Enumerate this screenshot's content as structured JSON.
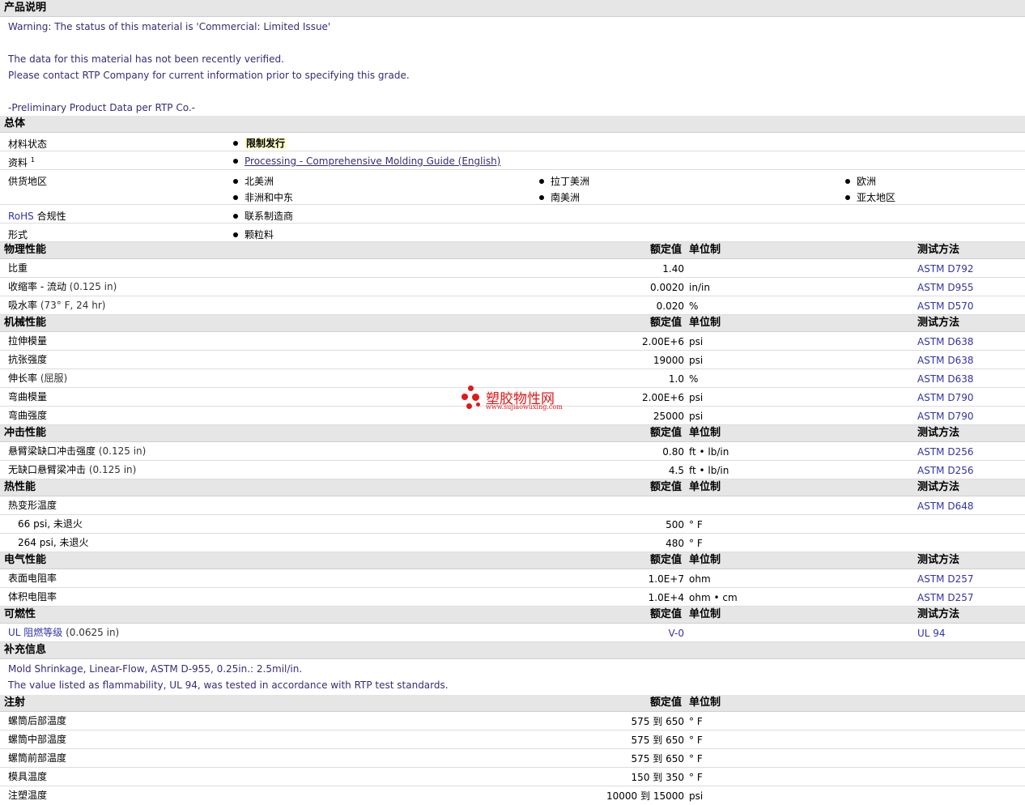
{
  "sections": {
    "desc": "产品说明",
    "general": "总体",
    "physical": "物理性能",
    "mechanical": "机械性能",
    "impact": "冲击性能",
    "thermal": "热性能",
    "electrical": "电气性能",
    "flammability": "可燃性",
    "supplemental": "补充信息",
    "injection": "注射"
  },
  "headers": {
    "nominal": "额定值",
    "unit": "单位制",
    "method": "测试方法"
  },
  "description": {
    "warning": "Warning: The status of this material is 'Commercial: Limited Issue'",
    "line2": "The data for this material has not been recently verified.",
    "line3": "Please contact RTP Company for current information prior to specifying this grade.",
    "line4": "-Preliminary Product Data per RTP Co.-"
  },
  "general": {
    "status_label": "材料状态",
    "status_value": "限制发行",
    "docs_label": "资料",
    "docs_sup": "1",
    "docs_link": "Processing - Comprehensive Molding Guide (English)",
    "regions_label": "供货地区",
    "regions": [
      "北美洲",
      "拉丁美洲",
      "欧洲",
      "非洲和中东",
      "南美洲",
      "亚太地区"
    ],
    "rohs_label_a": "RoHS",
    "rohs_label_b": " 合规性",
    "rohs_value": "联系制造商",
    "form_label": "形式",
    "form_value": "颗粒料"
  },
  "physical": [
    {
      "label": "比重",
      "param": "",
      "value": "1.40",
      "unit": "",
      "method": "ASTM D792"
    },
    {
      "label": "收缩率  - 流动",
      "param": "(0.125 in)",
      "value": "0.0020",
      "unit": "in/in",
      "method": "ASTM D955"
    },
    {
      "label": "吸水率",
      "param": "(73° F, 24 hr)",
      "value": "0.020",
      "unit": "%",
      "method": "ASTM D570"
    }
  ],
  "mechanical": [
    {
      "label": "拉伸模量",
      "param": "",
      "value": "2.00E+6",
      "unit": "psi",
      "method": "ASTM D638"
    },
    {
      "label": "抗张强度",
      "param": "",
      "value": "19000",
      "unit": "psi",
      "method": "ASTM D638"
    },
    {
      "label": "伸长率",
      "param": "(屈服)",
      "value": "1.0",
      "unit": "%",
      "method": "ASTM D638"
    },
    {
      "label": "弯曲模量",
      "param": "",
      "value": "2.00E+6",
      "unit": "psi",
      "method": "ASTM D790"
    },
    {
      "label": "弯曲强度",
      "param": "",
      "value": "25000",
      "unit": "psi",
      "method": "ASTM D790"
    }
  ],
  "impact": [
    {
      "label": "悬臂梁缺口冲击强度",
      "param": "(0.125 in)",
      "value": "0.80",
      "unit": "ft • lb/in",
      "method": "ASTM D256"
    },
    {
      "label": "无缺口悬臂梁冲击",
      "param": "(0.125 in)",
      "value": "4.5",
      "unit": "ft • lb/in",
      "method": "ASTM D256"
    }
  ],
  "thermal": {
    "hdt_label": "热变形温度",
    "hdt_method": "ASTM D648",
    "rows": [
      {
        "label": "66 psi, 未退火",
        "value": "500",
        "unit": "° F"
      },
      {
        "label": "264 psi, 未退火",
        "value": "480",
        "unit": "° F"
      }
    ]
  },
  "electrical": [
    {
      "label": "表面电阻率",
      "value": "1.0E+7",
      "unit": "ohm",
      "method": "ASTM D257"
    },
    {
      "label": "体积电阻率",
      "value": "1.0E+4",
      "unit": "ohm • cm",
      "method": "ASTM D257"
    }
  ],
  "flammability": [
    {
      "label": "UL 阻燃等级",
      "param": "(0.0625 in)",
      "value": "V-0",
      "unit": "",
      "method": "UL 94"
    }
  ],
  "supplemental": {
    "line1": "Mold Shrinkage, Linear-Flow, ASTM D-955, 0.25in.: 2.5mil/in.",
    "line2": "The value listed as flammability, UL 94, was tested in accordance with RTP test standards."
  },
  "injection": [
    {
      "label": "螺筒后部温度",
      "value": "575 到  650",
      "unit": "° F"
    },
    {
      "label": "螺筒中部温度",
      "value": "575 到  650",
      "unit": "° F"
    },
    {
      "label": "螺筒前部温度",
      "value": "575 到  650",
      "unit": "° F"
    },
    {
      "label": "模具温度",
      "value": "150 到  350",
      "unit": "° F"
    },
    {
      "label": "注塑温度",
      "value": "10000 到  15000",
      "unit": "psi"
    }
  ],
  "watermark": {
    "title": "塑胶物性网",
    "url": "www.sujiaowuxing.com"
  },
  "colors": {
    "section_bg": "#e6e6e6",
    "link": "#3a2a78",
    "method": "#3333aa",
    "watermark": "#e01818"
  }
}
